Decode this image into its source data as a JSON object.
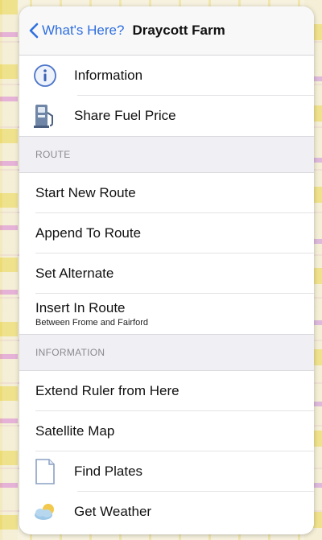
{
  "navbar": {
    "back_label": "What's Here?",
    "title": "Draycott Farm"
  },
  "top_items": [
    {
      "label": "Information",
      "icon": "info-icon"
    },
    {
      "label": "Share Fuel Price",
      "icon": "fuel-pump-icon"
    }
  ],
  "sections": [
    {
      "header": "ROUTE",
      "items": [
        {
          "label": "Start New Route"
        },
        {
          "label": "Append To Route"
        },
        {
          "label": "Set Alternate"
        },
        {
          "label": "Insert In Route",
          "sublabel": "Between Frome and Fairford"
        }
      ]
    },
    {
      "header": "INFORMATION",
      "items": [
        {
          "label": "Extend Ruler from Here"
        },
        {
          "label": "Satellite Map"
        },
        {
          "label": "Find Plates",
          "icon": "document-icon"
        },
        {
          "label": "Get Weather",
          "icon": "weather-icon"
        }
      ]
    }
  ],
  "colors": {
    "accent": "#2f6fe0",
    "section_bg": "#efeff4"
  }
}
